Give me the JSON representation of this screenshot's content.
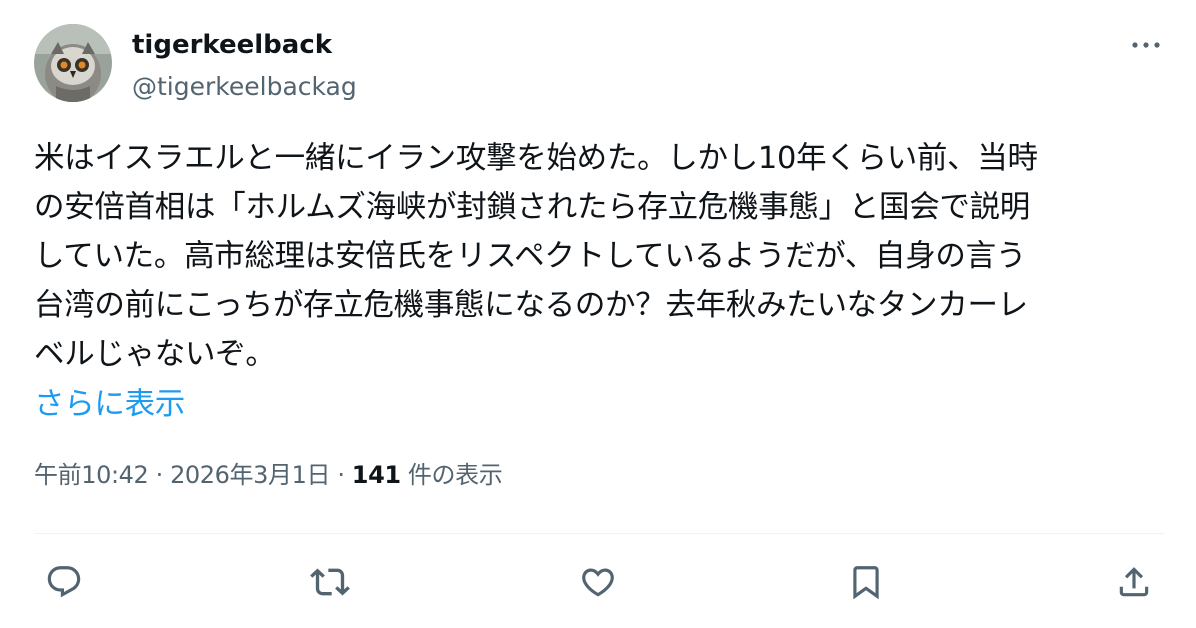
{
  "author": {
    "display_name": "tigerkeelback",
    "handle": "@tigerkeelbackag",
    "avatar_icon": "owl-avatar"
  },
  "tweet": {
    "lines": [
      "米はイスラエルと一緒にイラン攻撃を始めた。しかし10年くらい前、当時",
      "の安倍首相は「ホルムズ海峡が封鎖されたら存立危機事態」と国会で説明",
      "していた。高市総理は安倍氏をリスペクトしているようだが、自身の言う",
      "台湾の前にこっちが存立危機事態になるのか？去年秋みたいなタンカーレ",
      "ベルじゃないぞ。"
    ],
    "show_more": "さらに表示"
  },
  "meta": {
    "time": "午前10:42",
    "sep1": " · ",
    "date": "2026年3月1日",
    "sep2": " · ",
    "views_count": "141",
    "views_label": " 件の表示"
  },
  "actions": [
    "reply-icon",
    "retweet-icon",
    "like-icon",
    "bookmark-icon",
    "share-icon"
  ],
  "colors": {
    "text": "#0f1419",
    "secondary": "#536471",
    "link": "#1d9bf0",
    "divider": "#eff3f4"
  }
}
